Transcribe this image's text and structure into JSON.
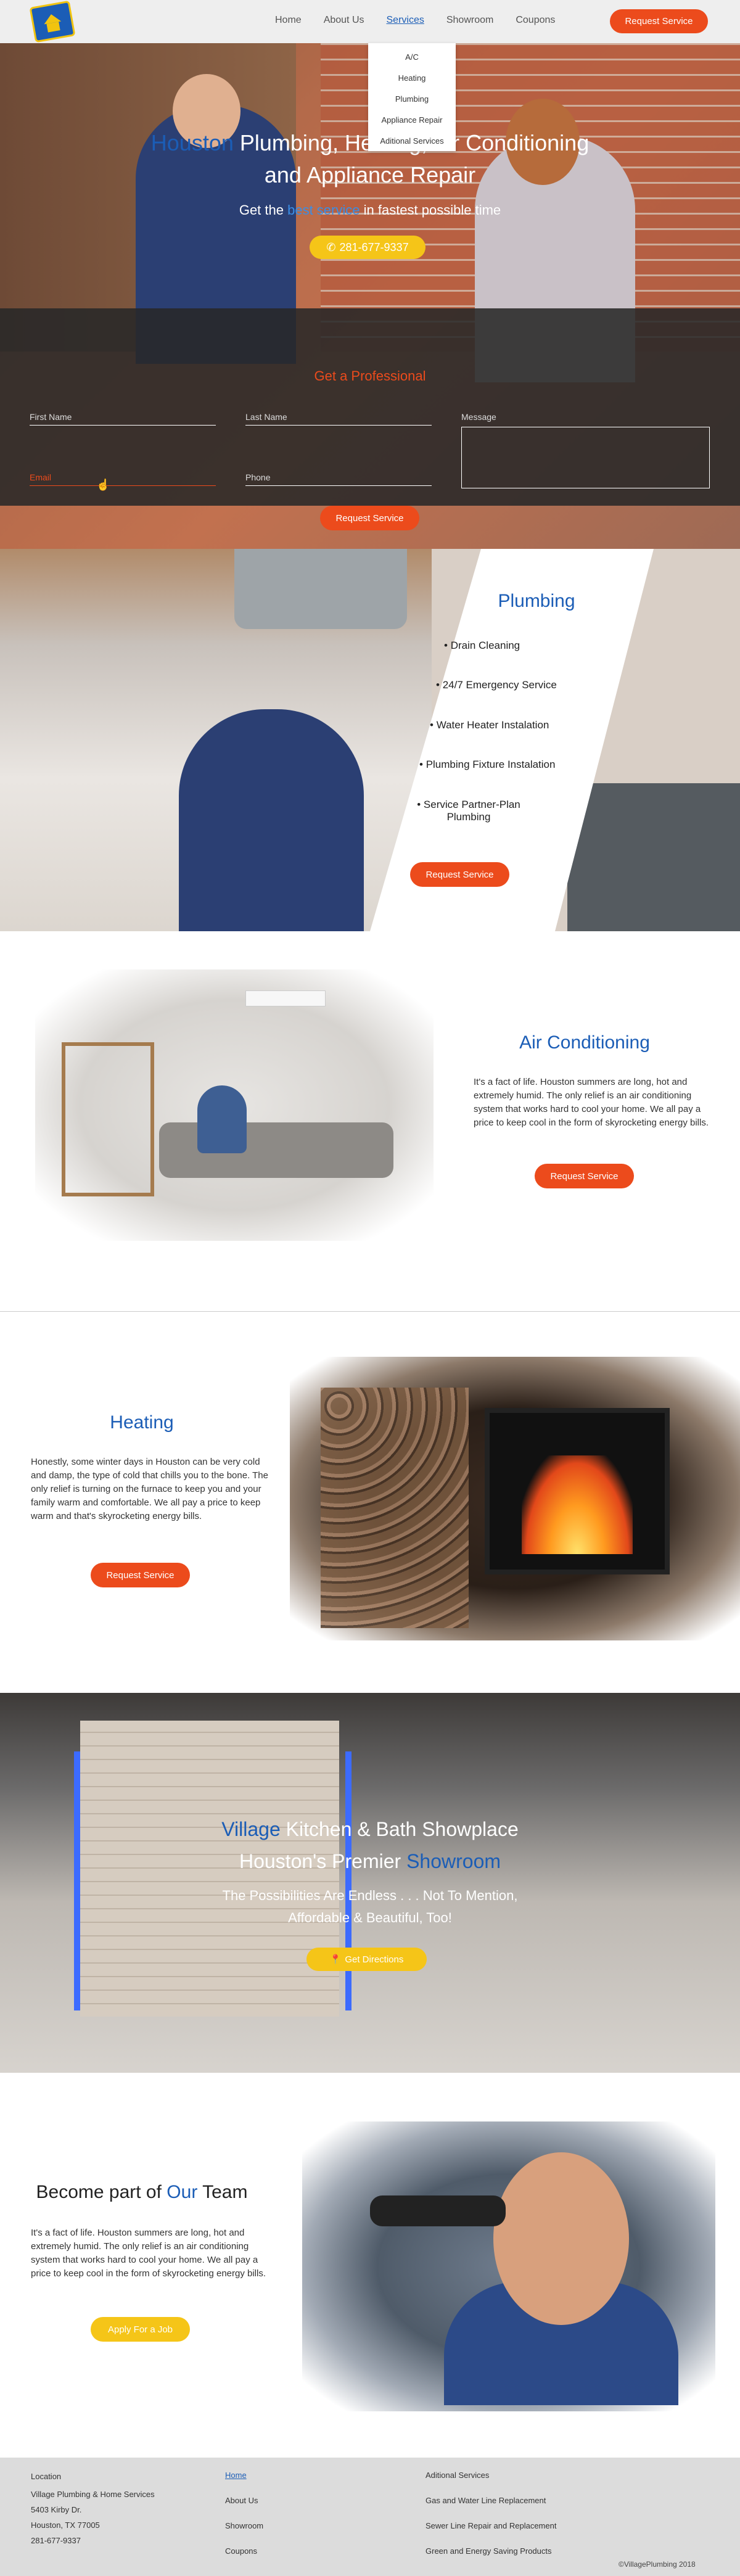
{
  "nav": {
    "items": [
      "Home",
      "About Us",
      "Services",
      "Showroom",
      "Coupons"
    ],
    "active": "Services",
    "request_label": "Request Service"
  },
  "services_dropdown": [
    "A/C",
    "Heating",
    "Plumbing",
    "Appliance Repair",
    "Aditional Services"
  ],
  "hero": {
    "title_blue": "Houston",
    "title_rest": " Plumbing, Heating, Air Conditioning",
    "title_line2": "and Appliance Repair",
    "sub_pre": "Get the ",
    "sub_blue": "best service",
    "sub_post": " in fastest possible time",
    "phone": "281-677-9337"
  },
  "form": {
    "title": "Get a Professional",
    "first_name": "First Name",
    "last_name": "Last Name",
    "message": "Message",
    "email": "Email",
    "phone": "Phone",
    "button": "Request Service"
  },
  "plumbing": {
    "title": "Plumbing",
    "items": [
      "Drain Cleaning",
      "24/7 Emergency Service",
      "Water Heater Instalation",
      "Plumbing Fixture Instalation",
      "Service Partner-Plan"
    ],
    "item5_line2": "Plumbing",
    "button": "Request Service"
  },
  "ac": {
    "title": "Air Conditioning",
    "text": "It's a fact of life. Houston summers are long, hot and extremely humid. The only relief is an air conditioning system that works hard to cool your home. We all pay a price to keep cool in the form of skyrocketing energy bills.",
    "button": "Request Service"
  },
  "heating": {
    "title": "Heating",
    "text": "Honestly, some winter days in Houston can be very cold and damp, the type of cold that chills you to the bone. The only relief is turning on the furnace to keep you and your family warm and comfortable. We all pay a price to keep warm and that's skyrocketing energy bills.",
    "button": "Request Service"
  },
  "showroom": {
    "title_blue": "Village",
    "title_rest": " Kitchen & Bath Showplace",
    "title_line2_pre": "Houston's Premier ",
    "title_line2_blue": "Showroom",
    "sub_line1": "The Possibilities Are Endless . . . Not To Mention,",
    "sub_line2": "Affordable & Beautiful, Too!",
    "button": "Get Directions"
  },
  "team": {
    "title_pre": "Become part of ",
    "title_blue": "Our",
    "title_post": " Team",
    "text": "It's a fact of life. Houston summers are long, hot and extremely humid. The only relief is an air conditioning system that works hard to cool your home. We all pay a price to keep cool in the form of skyrocketing energy bills.",
    "button": "Apply For a Job"
  },
  "footer": {
    "location_title": "Location",
    "location_lines": [
      "Village Plumbing & Home Services",
      "5403 Kirby Dr.",
      "Houston, TX 77005",
      "281-677-9337"
    ],
    "links": [
      "Home",
      "About Us",
      "Showroom",
      "Coupons"
    ],
    "additional_title": "Aditional Services",
    "additional": [
      "Gas and Water Line Replacement",
      "Sewer Line Repair and Replacement",
      "Green and Energy Saving Products"
    ],
    "copyright": "©VillagePlumbing 2018"
  },
  "colors": {
    "brand_blue": "#1b5db6",
    "accent_orange": "#ec4b1c",
    "accent_yellow": "#f5c518"
  }
}
